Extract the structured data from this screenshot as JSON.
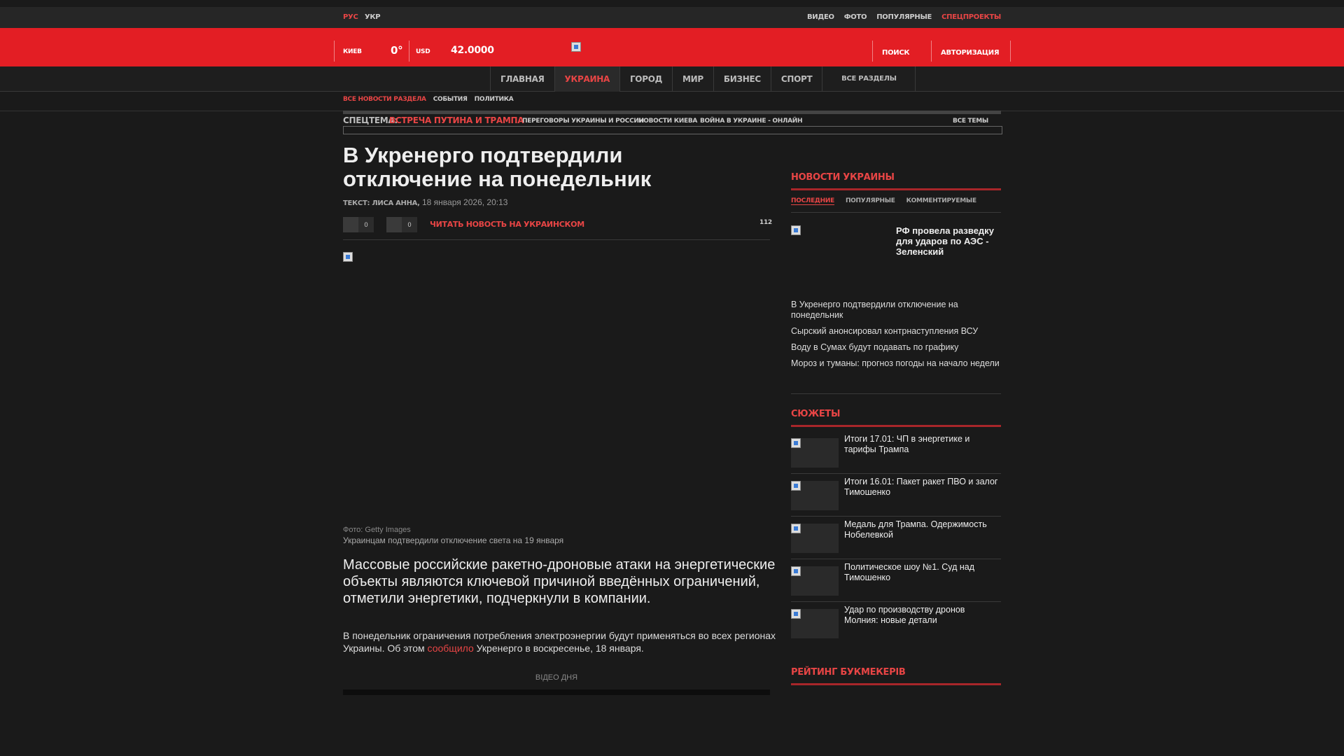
{
  "top": {
    "lang_ru": "РУС",
    "lang_ua": "УКР",
    "links": [
      "ВИДЕО",
      "ФОТО",
      "ПОПУЛЯРНЫЕ",
      "СПЕЦПРОЕКТЫ"
    ]
  },
  "header": {
    "city": "КИЕВ",
    "temperature": "0°",
    "currency": "USD",
    "rate": "42.0000",
    "search": "ПОИСК",
    "auth": "АВТОРИЗАЦИЯ"
  },
  "nav": {
    "items": [
      "ГЛАВНАЯ",
      "УКРАИНА",
      "ГОРОД",
      "МИР",
      "БИЗНЕС",
      "СПОРТ"
    ],
    "all_sections": "ВСЕ РАЗДЕЛЫ"
  },
  "subnav": {
    "all_news": "ВСЕ НОВОСТИ РАЗДЕЛА",
    "events": "СОБЫТИЯ",
    "politics": "ПОЛИТИКА"
  },
  "special_topic": {
    "label": "СПЕЦТЕМА:",
    "topic": "ВСТРЕЧА ПУТИНА И ТРАМПА",
    "links": [
      "ПЕРЕГОВОРЫ УКРАИНЫ И РОССИИ",
      "НОВОСТИ КИЕВА",
      "ВОЙНА В УКРАИНЕ - ОНЛАЙН"
    ],
    "all_topics": "ВСЕ ТЕМЫ"
  },
  "article": {
    "title": "В Укренерго подтвердили отключение на понедельник",
    "author": "ТЕКСТ: ЛИСА АННА,",
    "date": "18 января 2026, 20:13",
    "share_count_1": "0",
    "share_count_2": "0",
    "read_ua": "ЧИТАТЬ НОВОСТЬ НА УКРАИНСКОМ",
    "views": "112",
    "photo_credit": "Фото: Getty Images",
    "photo_caption": "Украинцам подтвердили отключение света на 19 января",
    "lead": "Массовые российские ракетно-дроновые атаки на энергетические объекты являются ключевой причиной введённых ограничений, отметили энергетики, подчеркнули в компании.",
    "para_start": "В понедельник ограничения потребления электроэнергии будут применяться во всех регионах Украины. Об этом ",
    "para_link": "сообщило",
    "para_end": " Укренерго в воскресенье, 18 января.",
    "video_of_day": "ВІДЕО ДНЯ"
  },
  "sidebar": {
    "news_heading": "НОВОСТИ УКРАИНЫ",
    "tabs": [
      "ПОСЛЕДНИЕ",
      "ПОПУЛЯРНЫЕ",
      "КОММЕНТИРУЕМЫЕ"
    ],
    "featured": "РФ провела разведку для ударов по АЭС - Зеленский",
    "news": [
      "В Укренерго подтвердили отключение на понедельник",
      "Сырский анонсировал контрнаступления ВСУ",
      "Воду в Сумах будут подавать по графику",
      "Мороз и туманы: прогноз погоды на начало недели"
    ],
    "stories_heading": "СЮЖЕТЫ",
    "stories": [
      "Итоги 17.01: ЧП в энергетике и тарифы Трампа",
      "Итоги 16.01: Пакет ракет ПВО и залог Тимошенко",
      "Медаль для Трампа. Одержимость Нобелевкой",
      "Политическое шоу №1. Суд над Тимошенко",
      "Удар по производству дронов Молния: новые детали"
    ],
    "rating_heading": "РЕЙТИНГ БУКМЕКЕРІВ"
  },
  "colors": {
    "brand_red": "#e31e24",
    "accent_red": "#e84545",
    "background": "#1a1a1a"
  }
}
